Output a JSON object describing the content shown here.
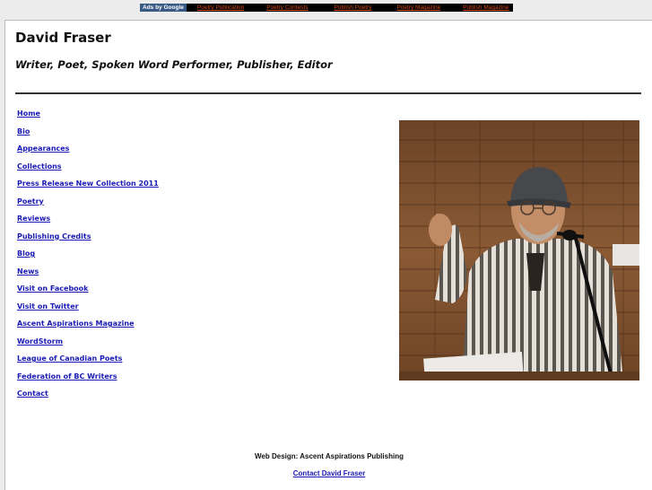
{
  "ad_bar": {
    "label": "Ads by Google",
    "links": [
      "Poetry Publication",
      "Poetry Contests",
      "Publish Poetry",
      "Poetry Magazine",
      "Publish Magazine"
    ]
  },
  "header": {
    "title": "David Fraser",
    "subtitle": "Writer, Poet, Spoken Word Performer, Publisher, Editor"
  },
  "nav": {
    "items": [
      "Home",
      "Bio",
      "Appearances",
      "Collections",
      "Press Release New Collection 2011",
      "Poetry",
      "Reviews",
      "Publishing Credits",
      "Blog",
      "News",
      "Visit on Facebook",
      "Visit on Twitter",
      "Ascent Aspirations Magazine",
      "WordStorm",
      "League of Canadian Poets",
      "Federation of BC Writers",
      "Contact"
    ]
  },
  "footer": {
    "credit": "Web Design: Ascent Aspirations Publishing",
    "contact_link": "Contact David Fraser"
  }
}
